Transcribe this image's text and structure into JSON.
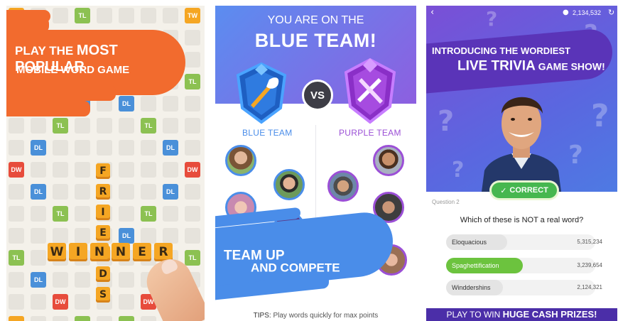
{
  "colors": {
    "orange": "#f26b2e",
    "tile": "#f5a623",
    "tl": "#8cc152",
    "dl": "#4a90d9",
    "tw": "#f5a623",
    "dw": "#e74c3c",
    "blue_team": "#4a8de9",
    "purple_team": "#9b4fd6",
    "correct_green": "#46b74f"
  },
  "panel1": {
    "banner_line1_pre": "PLAY THE ",
    "banner_line1_bold": "MOST POPULAR",
    "banner_line2": "MOBILE WORD GAME",
    "bonus_labels": {
      "tl": "TL",
      "dl": "DL",
      "tw": "TW",
      "dw": "DW"
    },
    "word_horizontal": [
      "W",
      "I",
      "N",
      "N",
      "E",
      "R"
    ],
    "word_vertical": [
      "F",
      "R",
      "I",
      "E",
      "N",
      "D",
      "S"
    ]
  },
  "panel2": {
    "header_line1": "YOU  ARE ON THE",
    "header_line2": "BLUE TEAM!",
    "vs": "VS",
    "blue_team_label": "BLUE TEAM",
    "purple_team_label": "PURPLE TEAM",
    "banner_line1": "TEAM UP",
    "banner_line2": "AND COMPETE",
    "tips_key": "TIPS:",
    "tips_text": " Play words quickly for max points"
  },
  "panel3": {
    "coin_count": "2,134,532",
    "banner_line1": "INTRODUCING THE WORDIEST",
    "banner_line2": "LIVE TRIVIA",
    "banner_line2_tail": " GAME SHOW!",
    "correct_label": "CORRECT",
    "question_number": "Question 2",
    "question": "Which of these is NOT a real word?",
    "options": [
      {
        "label": "Eloquacious",
        "count": "5,315,234",
        "selected": false
      },
      {
        "label": "Spaghettification",
        "count": "3,239,654",
        "selected": true
      },
      {
        "label": "Winddershins",
        "count": "2,124,321",
        "selected": false
      }
    ],
    "bottom_pre": "PLAY TO WIN ",
    "bottom_bold": "HUGE CASH PRIZES!"
  }
}
